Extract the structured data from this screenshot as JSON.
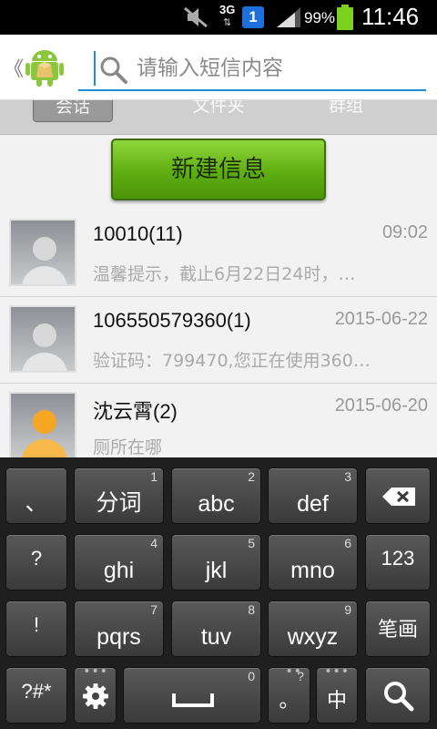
{
  "status_bar": {
    "network": "3G",
    "sim_badge": "1",
    "battery": "99%",
    "time": "11:46"
  },
  "search": {
    "placeholder": "请输入短信内容"
  },
  "tabs": [
    {
      "label": "会话"
    },
    {
      "label": "文件夹"
    },
    {
      "label": "群组"
    }
  ],
  "new_message_label": "新建信息",
  "messages": [
    {
      "contact": "10010(11)",
      "time": "09:02",
      "preview": "温馨提示，截止6月22日24时，…",
      "avatar": "gray"
    },
    {
      "contact": "106550579360(1)",
      "time": "2015-06-22",
      "preview": "验证码：799470,您正在使用360…",
      "avatar": "gray"
    },
    {
      "contact": "沈云霄(2)",
      "time": "2015-06-20",
      "preview": "厕所在哪",
      "avatar": "orange"
    }
  ],
  "keyboard": {
    "row1": [
      {
        "label": "、",
        "num": ""
      },
      {
        "label": "分词",
        "num": "1"
      },
      {
        "label": "abc",
        "num": "2"
      },
      {
        "label": "def",
        "num": "3"
      }
    ],
    "row2": [
      {
        "label": "?",
        "num": ""
      },
      {
        "label": "ghi",
        "num": "4"
      },
      {
        "label": "jkl",
        "num": "5"
      },
      {
        "label": "mno",
        "num": "6"
      },
      {
        "label": "123",
        "num": ""
      }
    ],
    "row3": [
      {
        "label": "!",
        "num": ""
      },
      {
        "label": "pqrs",
        "num": "7"
      },
      {
        "label": "tuv",
        "num": "8"
      },
      {
        "label": "wxyz",
        "num": "9"
      },
      {
        "label": "笔画",
        "num": ""
      }
    ],
    "row4": {
      "symbols": "?#*",
      "space_num": "0",
      "period": "。",
      "period_hint": "?",
      "lang": "中"
    }
  },
  "colors": {
    "accent": "#1e8fd6",
    "new_button": "#5fae12"
  }
}
